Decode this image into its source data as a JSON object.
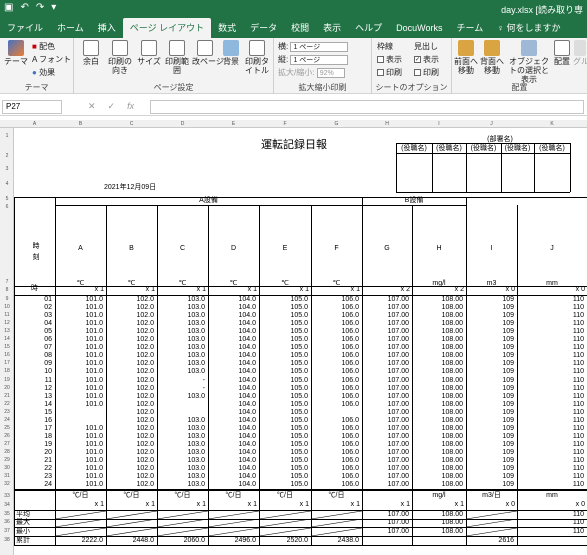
{
  "titlebar": {
    "filename": "day.xlsx [読み取り専"
  },
  "tabs": [
    "ファイル",
    "ホーム",
    "挿入",
    "ページ レイアウト",
    "数式",
    "データ",
    "校閲",
    "表示",
    "ヘルプ",
    "DocuWorks",
    "チーム",
    "♀ 何をしますか"
  ],
  "active_tab_index": 3,
  "ribbon": {
    "theme": {
      "themes": "テーマ",
      "colors": "配色",
      "fonts": "フォント",
      "effects": "効果",
      "label": "テーマ"
    },
    "page_setup": {
      "margins": "余白",
      "orientation": "印刷の向き",
      "size": "サイズ",
      "print_area": "印刷範囲",
      "breaks": "改ページ",
      "background": "背景",
      "print_titles": "印刷タイトル",
      "label": "ページ設定"
    },
    "scale": {
      "width_label": "横:",
      "width_value": "1 ページ",
      "height_label": "縦:",
      "height_value": "1 ページ",
      "scale_label": "拡大/縮小:",
      "scale_value": "92%",
      "label": "拡大縮小印刷"
    },
    "sheet_options": {
      "gridlines": "枠線",
      "headings": "見出し",
      "view": "表示",
      "print": "印刷",
      "label": "シートのオプション"
    },
    "arrange": {
      "bring_forward": "前面へ移動",
      "send_backward": "背面へ移動",
      "selection_pane": "オブジェクトの選択と表示",
      "align": "配置",
      "group": "グル",
      "label": "配置"
    }
  },
  "formula_bar": {
    "cell_ref": "P27",
    "fx": "fx",
    "cancel": "✕",
    "enter": "✓",
    "value": ""
  },
  "sheet": {
    "title": "運転記録日報",
    "date": "2021年12月09日",
    "dept_label": "(部署名)",
    "approval": [
      "(役職名)",
      "(役職名)",
      "(役職名)",
      "(役職名)",
      "(役職名)"
    ],
    "equip_a": "A設備",
    "equip_b": "B設備",
    "time_label": "時刻",
    "hour_label": "時",
    "columns": [
      "A",
      "B",
      "C",
      "D",
      "E",
      "F",
      "G",
      "H",
      "I",
      "J"
    ],
    "col_letters": [
      "A",
      "B",
      "C",
      "D",
      "E",
      "F",
      "G",
      "H",
      "I",
      "J",
      "K"
    ],
    "units": [
      "℃",
      "℃",
      "℃",
      "℃",
      "℃",
      "℃",
      "",
      "mg/l",
      "m3",
      "mm"
    ],
    "multipliers": [
      "x 1",
      "x 1",
      "x 1",
      "x 1",
      "x 1",
      "x 1",
      "x 2",
      "x 2",
      "x 0",
      "x 0"
    ],
    "hours": [
      "01",
      "02",
      "03",
      "04",
      "05",
      "06",
      "07",
      "08",
      "09",
      "10",
      "11",
      "12",
      "13",
      "14",
      "15",
      "16",
      "17",
      "18",
      "19",
      "20",
      "21",
      "22",
      "23",
      "24"
    ],
    "values": [
      [
        "101.0",
        "102.0",
        "103.0",
        "104.0",
        "105.0",
        "106.0",
        "107.00",
        "108.00",
        "109",
        "110"
      ],
      [
        "101.0",
        "102.0",
        "103.0",
        "104.0",
        "105.0",
        "106.0",
        "107.00",
        "108.00",
        "109",
        "110"
      ],
      [
        "101.0",
        "102.0",
        "103.0",
        "104.0",
        "105.0",
        "106.0",
        "107.00",
        "108.00",
        "109",
        "110"
      ],
      [
        "101.0",
        "102.0",
        "103.0",
        "104.0",
        "105.0",
        "106.0",
        "107.00",
        "108.00",
        "109",
        "110"
      ],
      [
        "101.0",
        "102.0",
        "103.0",
        "104.0",
        "105.0",
        "106.0",
        "107.00",
        "108.00",
        "109",
        "110"
      ],
      [
        "101.0",
        "102.0",
        "103.0",
        "104.0",
        "105.0",
        "106.0",
        "107.00",
        "108.00",
        "109",
        "110"
      ],
      [
        "101.0",
        "102.0",
        "103.0",
        "104.0",
        "105.0",
        "106.0",
        "107.00",
        "108.00",
        "109",
        "110"
      ],
      [
        "101.0",
        "102.0",
        "103.0",
        "104.0",
        "105.0",
        "106.0",
        "107.00",
        "108.00",
        "109",
        "110"
      ],
      [
        "101.0",
        "102.0",
        "103.0",
        "104.0",
        "105.0",
        "106.0",
        "107.00",
        "108.00",
        "109",
        "110"
      ],
      [
        "101.0",
        "102.0",
        "103.0",
        "104.0",
        "105.0",
        "106.0",
        "107.00",
        "108.00",
        "109",
        "110"
      ],
      [
        "101.0",
        "102.0",
        "-",
        "104.0",
        "105.0",
        "106.0",
        "107.00",
        "108.00",
        "109",
        "110"
      ],
      [
        "101.0",
        "102.0",
        "-",
        "104.0",
        "105.0",
        "106.0",
        "107.00",
        "108.00",
        "109",
        "110"
      ],
      [
        "101.0",
        "102.0",
        "103.0",
        "104.0",
        "105.0",
        "106.0",
        "107.00",
        "108.00",
        "109",
        "110"
      ],
      [
        "101.0",
        "102.0",
        "",
        "104.0",
        "105.0",
        "106.0",
        "107.00",
        "108.00",
        "109",
        "110"
      ],
      [
        "",
        "102.0",
        "",
        "104.0",
        "105.0",
        "",
        "107.00",
        "108.00",
        "109",
        "110"
      ],
      [
        "",
        "102.0",
        "103.0",
        "104.0",
        "105.0",
        "106.0",
        "107.00",
        "108.00",
        "109",
        "110"
      ],
      [
        "101.0",
        "102.0",
        "103.0",
        "104.0",
        "105.0",
        "106.0",
        "107.00",
        "108.00",
        "109",
        "110"
      ],
      [
        "101.0",
        "102.0",
        "103.0",
        "104.0",
        "105.0",
        "106.0",
        "107.00",
        "108.00",
        "109",
        "110"
      ],
      [
        "101.0",
        "102.0",
        "103.0",
        "104.0",
        "105.0",
        "106.0",
        "107.00",
        "108.00",
        "109",
        "110"
      ],
      [
        "101.0",
        "102.0",
        "103.0",
        "104.0",
        "105.0",
        "106.0",
        "107.00",
        "108.00",
        "109",
        "110"
      ],
      [
        "101.0",
        "102.0",
        "103.0",
        "104.0",
        "105.0",
        "106.0",
        "107.00",
        "108.00",
        "109",
        "110"
      ],
      [
        "101.0",
        "102.0",
        "103.0",
        "104.0",
        "105.0",
        "106.0",
        "107.00",
        "108.00",
        "109",
        "110"
      ],
      [
        "101.0",
        "102.0",
        "103.0",
        "104.0",
        "105.0",
        "106.0",
        "107.00",
        "108.00",
        "109",
        "110"
      ],
      [
        "101.0",
        "102.0",
        "103.0",
        "104.0",
        "105.0",
        "106.0",
        "107.00",
        "108.00",
        "109",
        "110"
      ]
    ],
    "summary_units": [
      "℃/日",
      "℃/日",
      "℃/日",
      "℃/日",
      "℃/日",
      "℃/日",
      "",
      "mg/l",
      "m3/日",
      "mm"
    ],
    "summary_mult": [
      "x 1",
      "x 1",
      "x 1",
      "x 1",
      "x 1",
      "x 1",
      "x 1",
      "x 1",
      "x 0",
      "x 0"
    ],
    "summary_labels": [
      "平均",
      "最大",
      "最小",
      "累計"
    ],
    "avg": [
      "",
      "",
      "",
      "",
      "",
      "",
      "107.00",
      "108.00",
      "",
      "110"
    ],
    "max": [
      "",
      "",
      "",
      "",
      "",
      "",
      "107.00",
      "108.00",
      "",
      "110"
    ],
    "min": [
      "",
      "",
      "",
      "",
      "",
      "",
      "107.00",
      "108.00",
      "",
      "110"
    ],
    "total": [
      "2222.0",
      "2448.0",
      "2060.0",
      "2496.0",
      "2520.0",
      "2438.0",
      "",
      "",
      "2616",
      ""
    ],
    "row_numbers": [
      "1",
      "2",
      "3",
      "4",
      "5",
      "6",
      "7",
      "8",
      "9",
      "10",
      "11",
      "12",
      "13",
      "14",
      "15",
      "16",
      "17",
      "18",
      "19",
      "20",
      "21",
      "22",
      "23",
      "24",
      "25",
      "26",
      "27",
      "28",
      "29",
      "30",
      "31",
      "32",
      "33",
      "34",
      "35",
      "36",
      "37",
      "38"
    ]
  }
}
